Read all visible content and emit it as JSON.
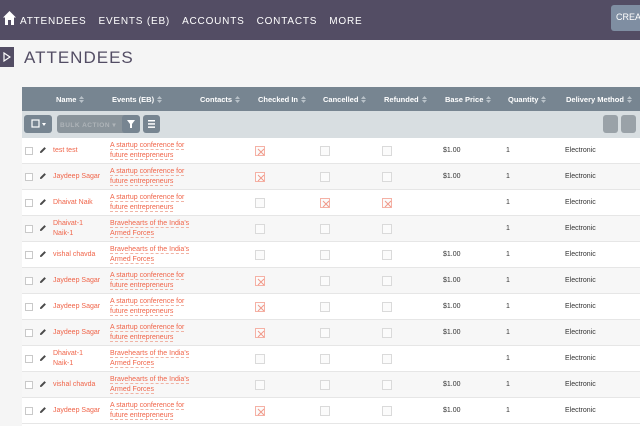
{
  "colors": {
    "nav_bg": "#534d64",
    "header_bg": "#778591",
    "link": "#f0654a"
  },
  "nav": {
    "home_icon": "home-icon",
    "items": [
      "ATTENDEES",
      "EVENTS (EB)",
      "ACCOUNTS",
      "CONTACTS",
      "MORE"
    ],
    "create_label": "CREA"
  },
  "page": {
    "title": "ATTENDEES",
    "toggle_icon": "play-icon"
  },
  "table": {
    "columns": [
      "Name",
      "Events (EB)",
      "Contacts",
      "Checked In",
      "Cancelled",
      "Refunded",
      "Base Price",
      "Quantity",
      "Delivery Method"
    ],
    "bulk_action_label": "BULK ACTION ▾",
    "rows": [
      {
        "name": [
          "test test"
        ],
        "event": [
          "A startup conference for",
          "future entrepreneurs"
        ],
        "contacts": "",
        "checked_in": true,
        "cancelled": false,
        "refunded": false,
        "base_price": "$1.00",
        "quantity": "1",
        "delivery": "Electronic"
      },
      {
        "name": [
          "Jaydeep Sagar"
        ],
        "event": [
          "A startup conference for",
          "future entrepreneurs"
        ],
        "contacts": "",
        "checked_in": true,
        "cancelled": false,
        "refunded": false,
        "base_price": "$1.00",
        "quantity": "1",
        "delivery": "Electronic"
      },
      {
        "name": [
          "Dhaivat Naik"
        ],
        "event": [
          "A startup conference for",
          "future entrepreneurs"
        ],
        "contacts": "",
        "checked_in": false,
        "cancelled": true,
        "refunded": true,
        "base_price": "",
        "quantity": "1",
        "delivery": "Electronic"
      },
      {
        "name": [
          "Dhaivat-1",
          "Naik-1"
        ],
        "event": [
          "Bravehearts of the India's",
          "Armed Forces"
        ],
        "contacts": "",
        "checked_in": false,
        "cancelled": false,
        "refunded": false,
        "base_price": "",
        "quantity": "1",
        "delivery": "Electronic"
      },
      {
        "name": [
          "vishal chavda"
        ],
        "event": [
          "Bravehearts of the India's",
          "Armed Forces"
        ],
        "contacts": "",
        "checked_in": false,
        "cancelled": false,
        "refunded": false,
        "base_price": "$1.00",
        "quantity": "1",
        "delivery": "Electronic"
      },
      {
        "name": [
          "Jaydeep Sagar"
        ],
        "event": [
          "A startup conference for",
          "future entrepreneurs"
        ],
        "contacts": "",
        "checked_in": true,
        "cancelled": false,
        "refunded": false,
        "base_price": "$1.00",
        "quantity": "1",
        "delivery": "Electronic"
      },
      {
        "name": [
          "Jaydeep Sagar"
        ],
        "event": [
          "A startup conference for",
          "future entrepreneurs"
        ],
        "contacts": "",
        "checked_in": true,
        "cancelled": false,
        "refunded": false,
        "base_price": "$1.00",
        "quantity": "1",
        "delivery": "Electronic"
      },
      {
        "name": [
          "Jaydeep Sagar"
        ],
        "event": [
          "A startup conference for",
          "future entrepreneurs"
        ],
        "contacts": "",
        "checked_in": true,
        "cancelled": false,
        "refunded": false,
        "base_price": "$1.00",
        "quantity": "1",
        "delivery": "Electronic"
      },
      {
        "name": [
          "Dhaivat-1",
          "Naik-1"
        ],
        "event": [
          "Bravehearts of the India's",
          "Armed Forces"
        ],
        "contacts": "",
        "checked_in": false,
        "cancelled": false,
        "refunded": false,
        "base_price": "",
        "quantity": "1",
        "delivery": "Electronic"
      },
      {
        "name": [
          "vishal chavda"
        ],
        "event": [
          "Bravehearts of the India's",
          "Armed Forces"
        ],
        "contacts": "",
        "checked_in": false,
        "cancelled": false,
        "refunded": false,
        "base_price": "$1.00",
        "quantity": "1",
        "delivery": "Electronic"
      },
      {
        "name": [
          "Jaydeep Sagar"
        ],
        "event": [
          "A startup conference for",
          "future entrepreneurs"
        ],
        "contacts": "",
        "checked_in": true,
        "cancelled": false,
        "refunded": false,
        "base_price": "$1.00",
        "quantity": "1",
        "delivery": "Electronic"
      }
    ]
  }
}
